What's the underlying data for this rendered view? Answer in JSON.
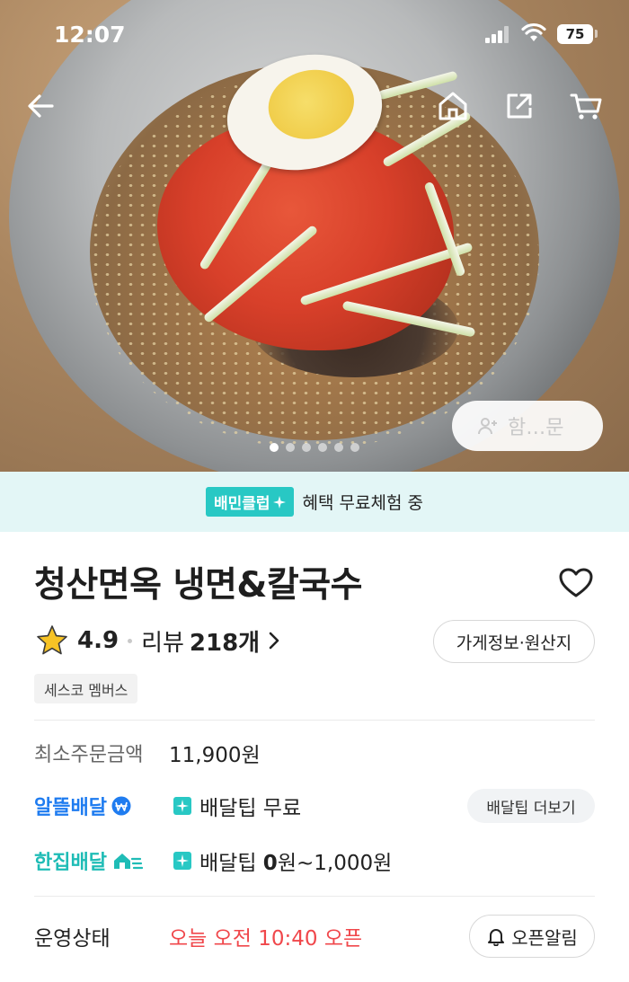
{
  "status_bar": {
    "time": "12:07",
    "battery": "75"
  },
  "hero": {
    "group_order_label": "함…문",
    "slide_count": 6,
    "active_slide": 1
  },
  "club_banner": {
    "badge": "배민클럽",
    "text": "혜택 무료체험 중"
  },
  "store": {
    "name": "청산면옥 냉면&칼국수",
    "rating": "4.9",
    "review_label": "리뷰",
    "review_count": "218개",
    "info_button": "가게정보·원산지",
    "tag": "세스코 멤버스"
  },
  "order": {
    "min_order_label": "최소주문금액",
    "min_order_value": "11,900원",
    "delivery_types": [
      {
        "brand": "알뜰배달",
        "fee_label": "배달팁",
        "fee_value": "무료"
      },
      {
        "brand": "한집배달",
        "fee_label": "배달팁",
        "fee_value_bold": "0",
        "fee_value_rest": "원~1,000원"
      }
    ],
    "more_button": "배달팁 더보기"
  },
  "operation": {
    "label": "운영상태",
    "status": "오늘 오전 10:40 오픈",
    "alert_button": "오픈알림"
  },
  "colors": {
    "club_bg": "#e3f6f6",
    "club_badge": "#28c8c4",
    "alddeul_blue": "#1f7cf0",
    "hanjip_teal": "#1fbcb6",
    "open_red": "#f0474b",
    "star": "#f7c325"
  }
}
